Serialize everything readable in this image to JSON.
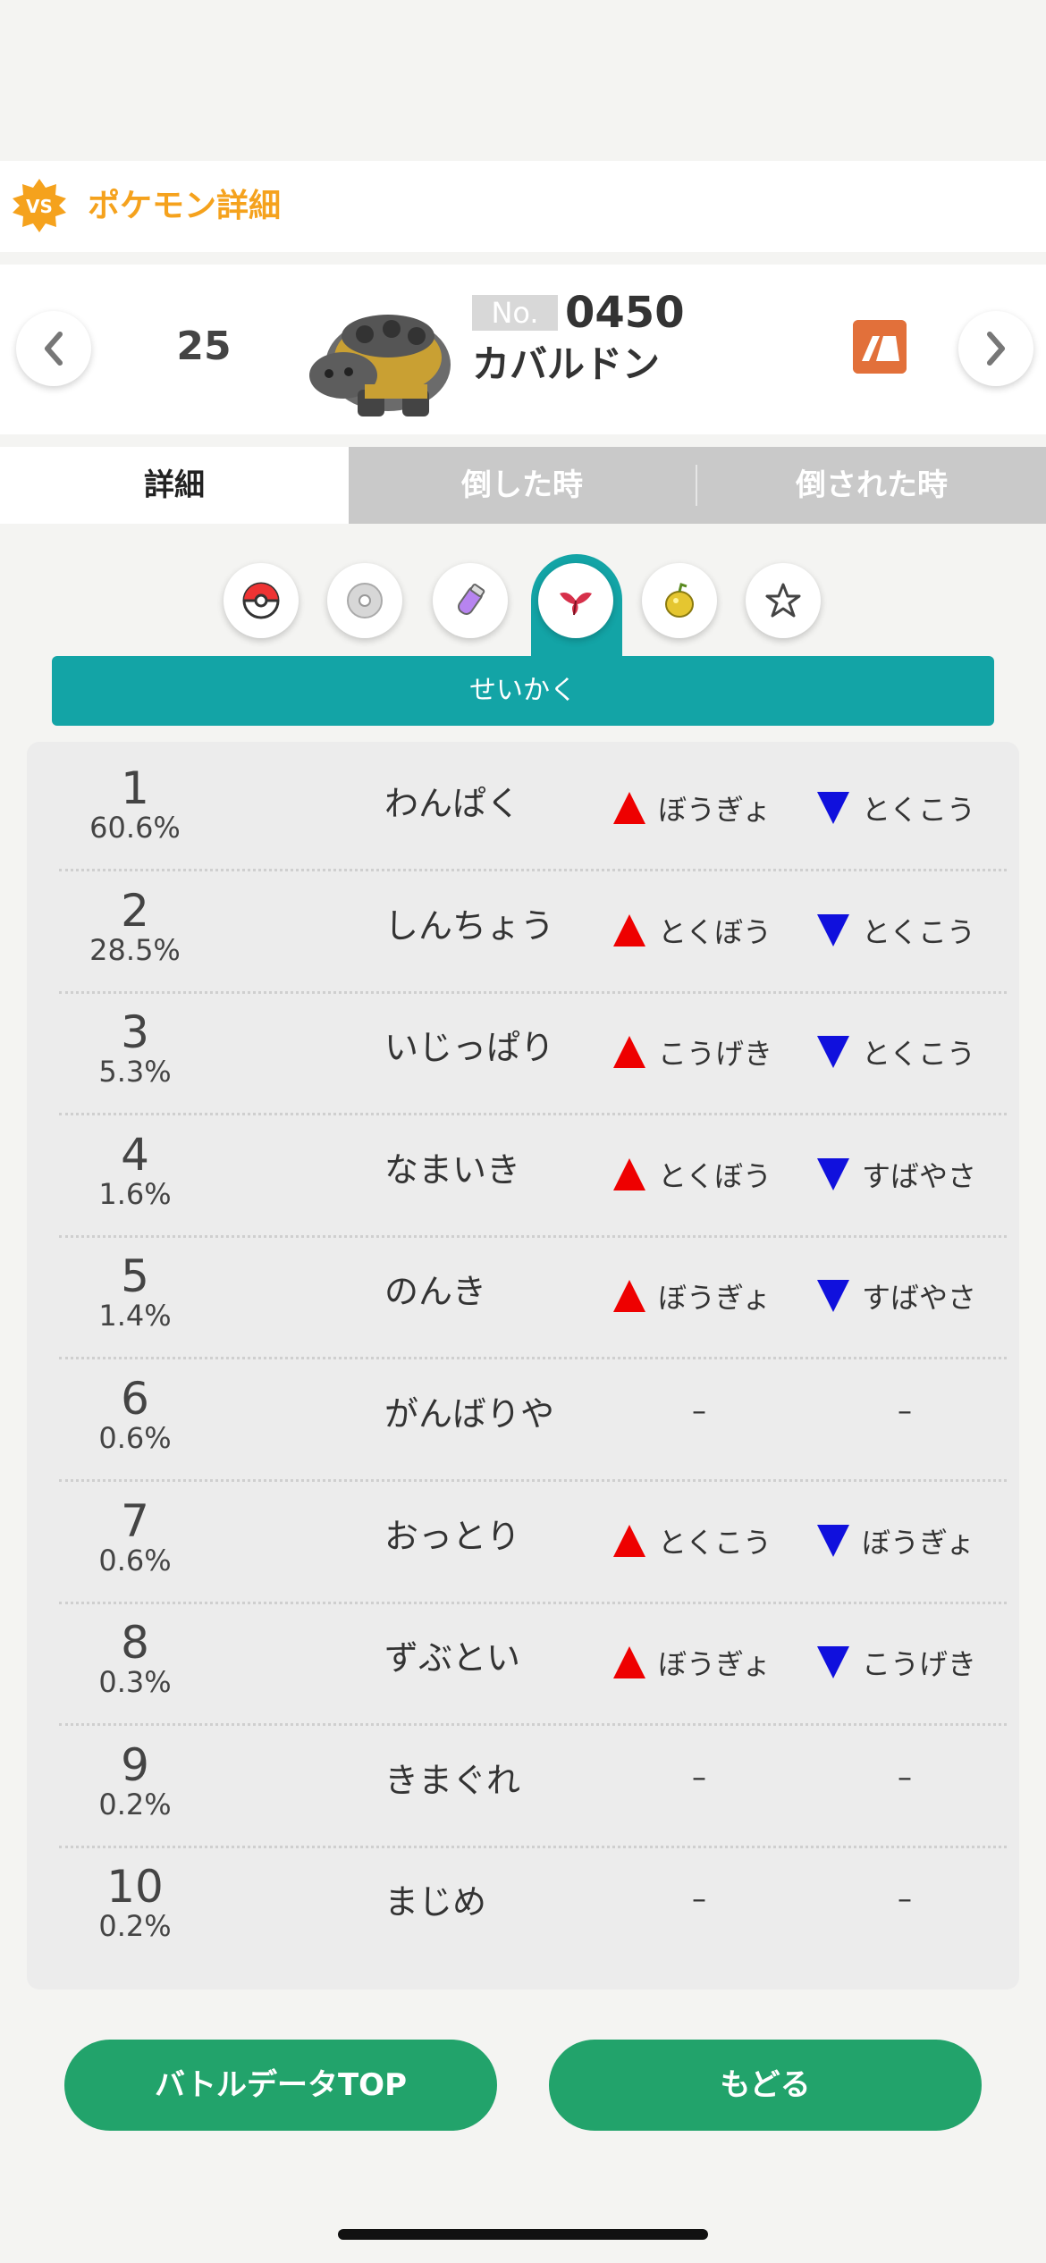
{
  "header": {
    "title": "ポケモン詳細",
    "badge": "VS"
  },
  "pokemon": {
    "rank": "25",
    "no_label": "No.",
    "number": "0450",
    "name": "カバルドン"
  },
  "tabs": [
    {
      "label": "詳細",
      "active": true
    },
    {
      "label": "倒した時",
      "active": false
    },
    {
      "label": "倒された時",
      "active": false
    }
  ],
  "categories": [
    "pokeball-icon",
    "disc-icon",
    "potion-icon",
    "nature-leaf-icon",
    "berry-icon",
    "ability-icon"
  ],
  "section_title": "せいかく",
  "natures": [
    {
      "rank": "1",
      "pct": "60.6%",
      "name": "わんぱく",
      "up": "ぼうぎょ",
      "down": "とくこう"
    },
    {
      "rank": "2",
      "pct": "28.5%",
      "name": "しんちょう",
      "up": "とくぼう",
      "down": "とくこう"
    },
    {
      "rank": "3",
      "pct": "5.3%",
      "name": "いじっぱり",
      "up": "こうげき",
      "down": "とくこう"
    },
    {
      "rank": "4",
      "pct": "1.6%",
      "name": "なまいき",
      "up": "とくぼう",
      "down": "すばやさ"
    },
    {
      "rank": "5",
      "pct": "1.4%",
      "name": "のんき",
      "up": "ぼうぎょ",
      "down": "すばやさ"
    },
    {
      "rank": "6",
      "pct": "0.6%",
      "name": "がんばりや",
      "up": "",
      "down": ""
    },
    {
      "rank": "7",
      "pct": "0.6%",
      "name": "おっとり",
      "up": "とくこう",
      "down": "ぼうぎょ"
    },
    {
      "rank": "8",
      "pct": "0.3%",
      "name": "ずぶとい",
      "up": "ぼうぎょ",
      "down": "こうげき"
    },
    {
      "rank": "9",
      "pct": "0.2%",
      "name": "きまぐれ",
      "up": "",
      "down": ""
    },
    {
      "rank": "10",
      "pct": "0.2%",
      "name": "まじめ",
      "up": "",
      "down": ""
    }
  ],
  "neutral_mark": "–",
  "buttons": {
    "top": "バトルデータTOP",
    "back": "もどる"
  },
  "colors": {
    "teal": "#13a4a6",
    "green": "#22a36b",
    "orange": "#f5a21d",
    "up": "#ee0000",
    "down": "#1010dd"
  }
}
